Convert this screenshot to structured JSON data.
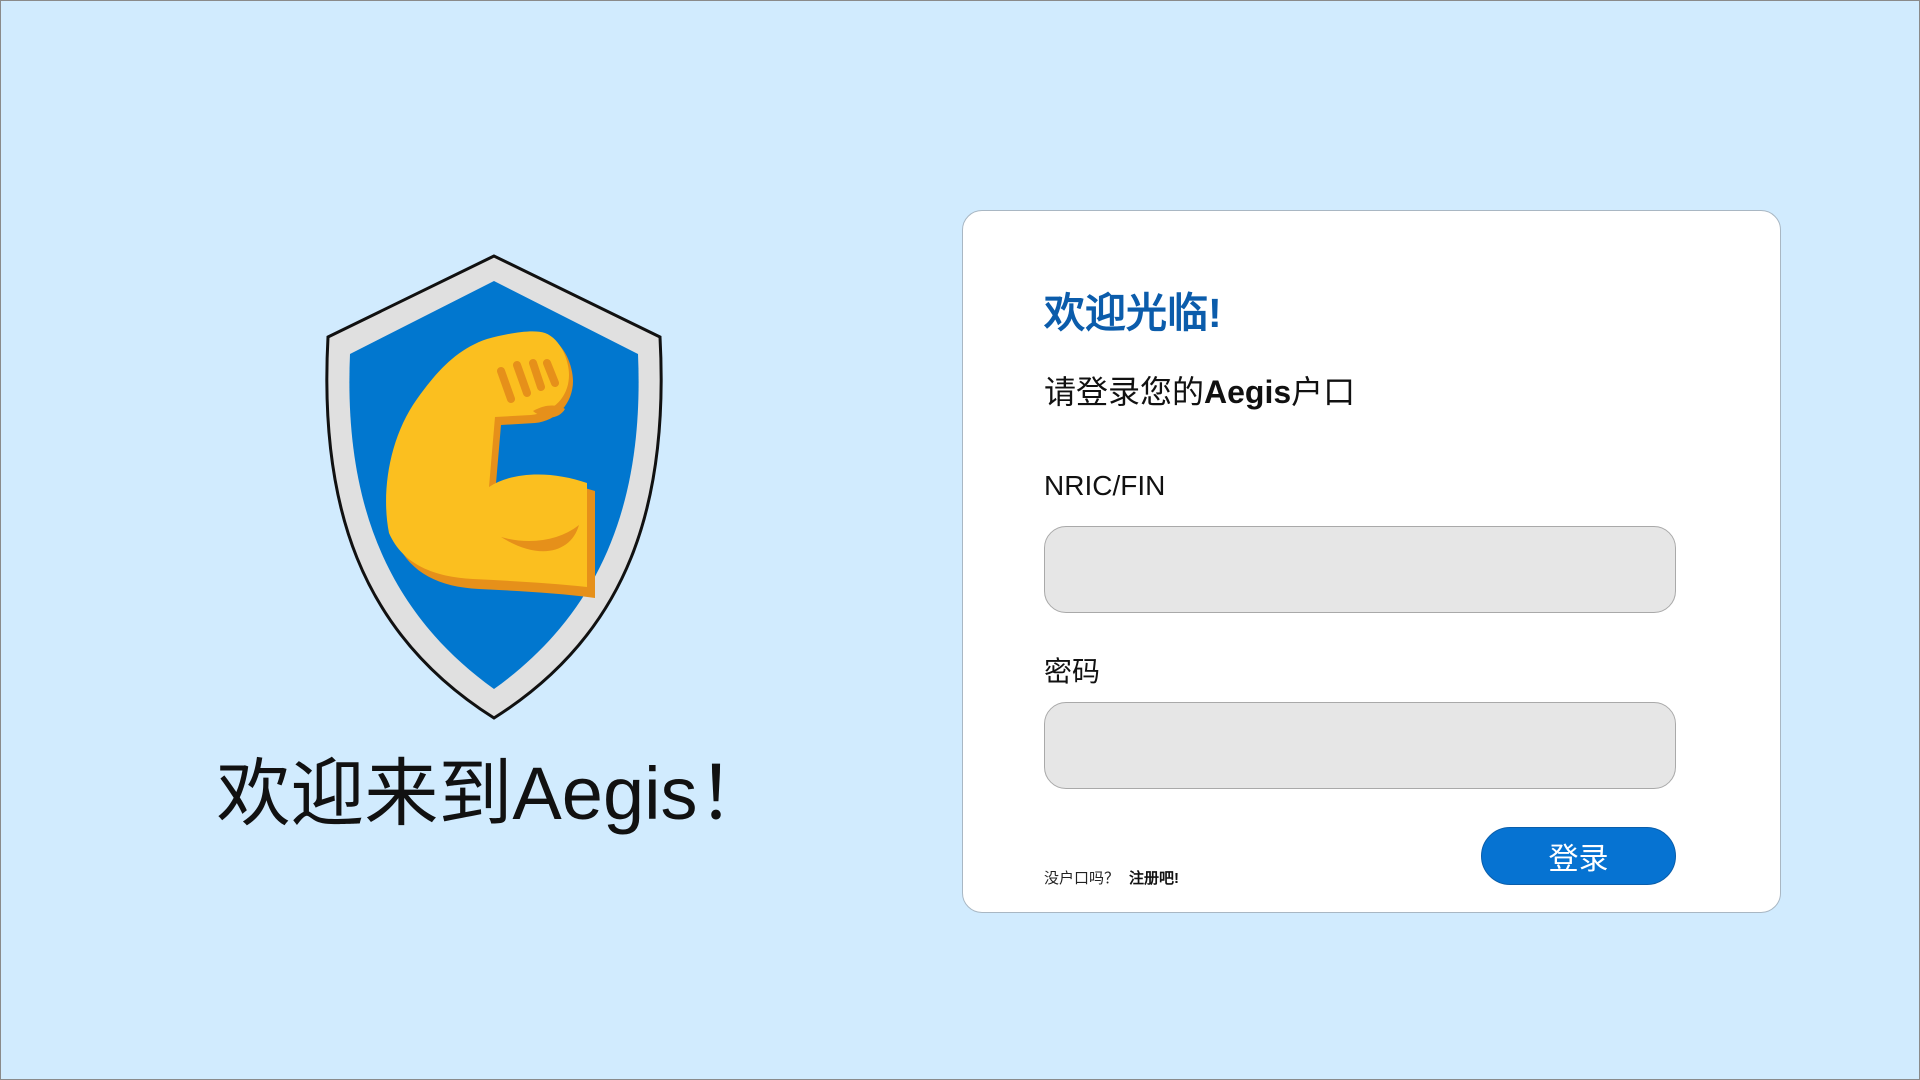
{
  "brand": {
    "welcome_text": "欢迎来到Aegis！",
    "logo_icon": "shield-flexed-biceps-icon",
    "colors": {
      "shield_blue": "#0177cf",
      "shield_rim": "#e0e0e0",
      "arm_yellow": "#fbbf1f",
      "arm_shadow": "#e6901a"
    }
  },
  "card": {
    "title": "欢迎光临!",
    "subtitle_prefix": "请登录您的",
    "subtitle_brand": "Aegis",
    "subtitle_suffix": "户口",
    "nric_label": "NRIC/FIN",
    "nric_value": "",
    "password_label": "密码",
    "password_value": "",
    "no_account_text": "没户口吗？",
    "register_link": "注册吧!",
    "login_button": "登录"
  },
  "colors": {
    "background": "#d1ebfe",
    "title": "#0b5cab",
    "button": "#0673d2"
  }
}
